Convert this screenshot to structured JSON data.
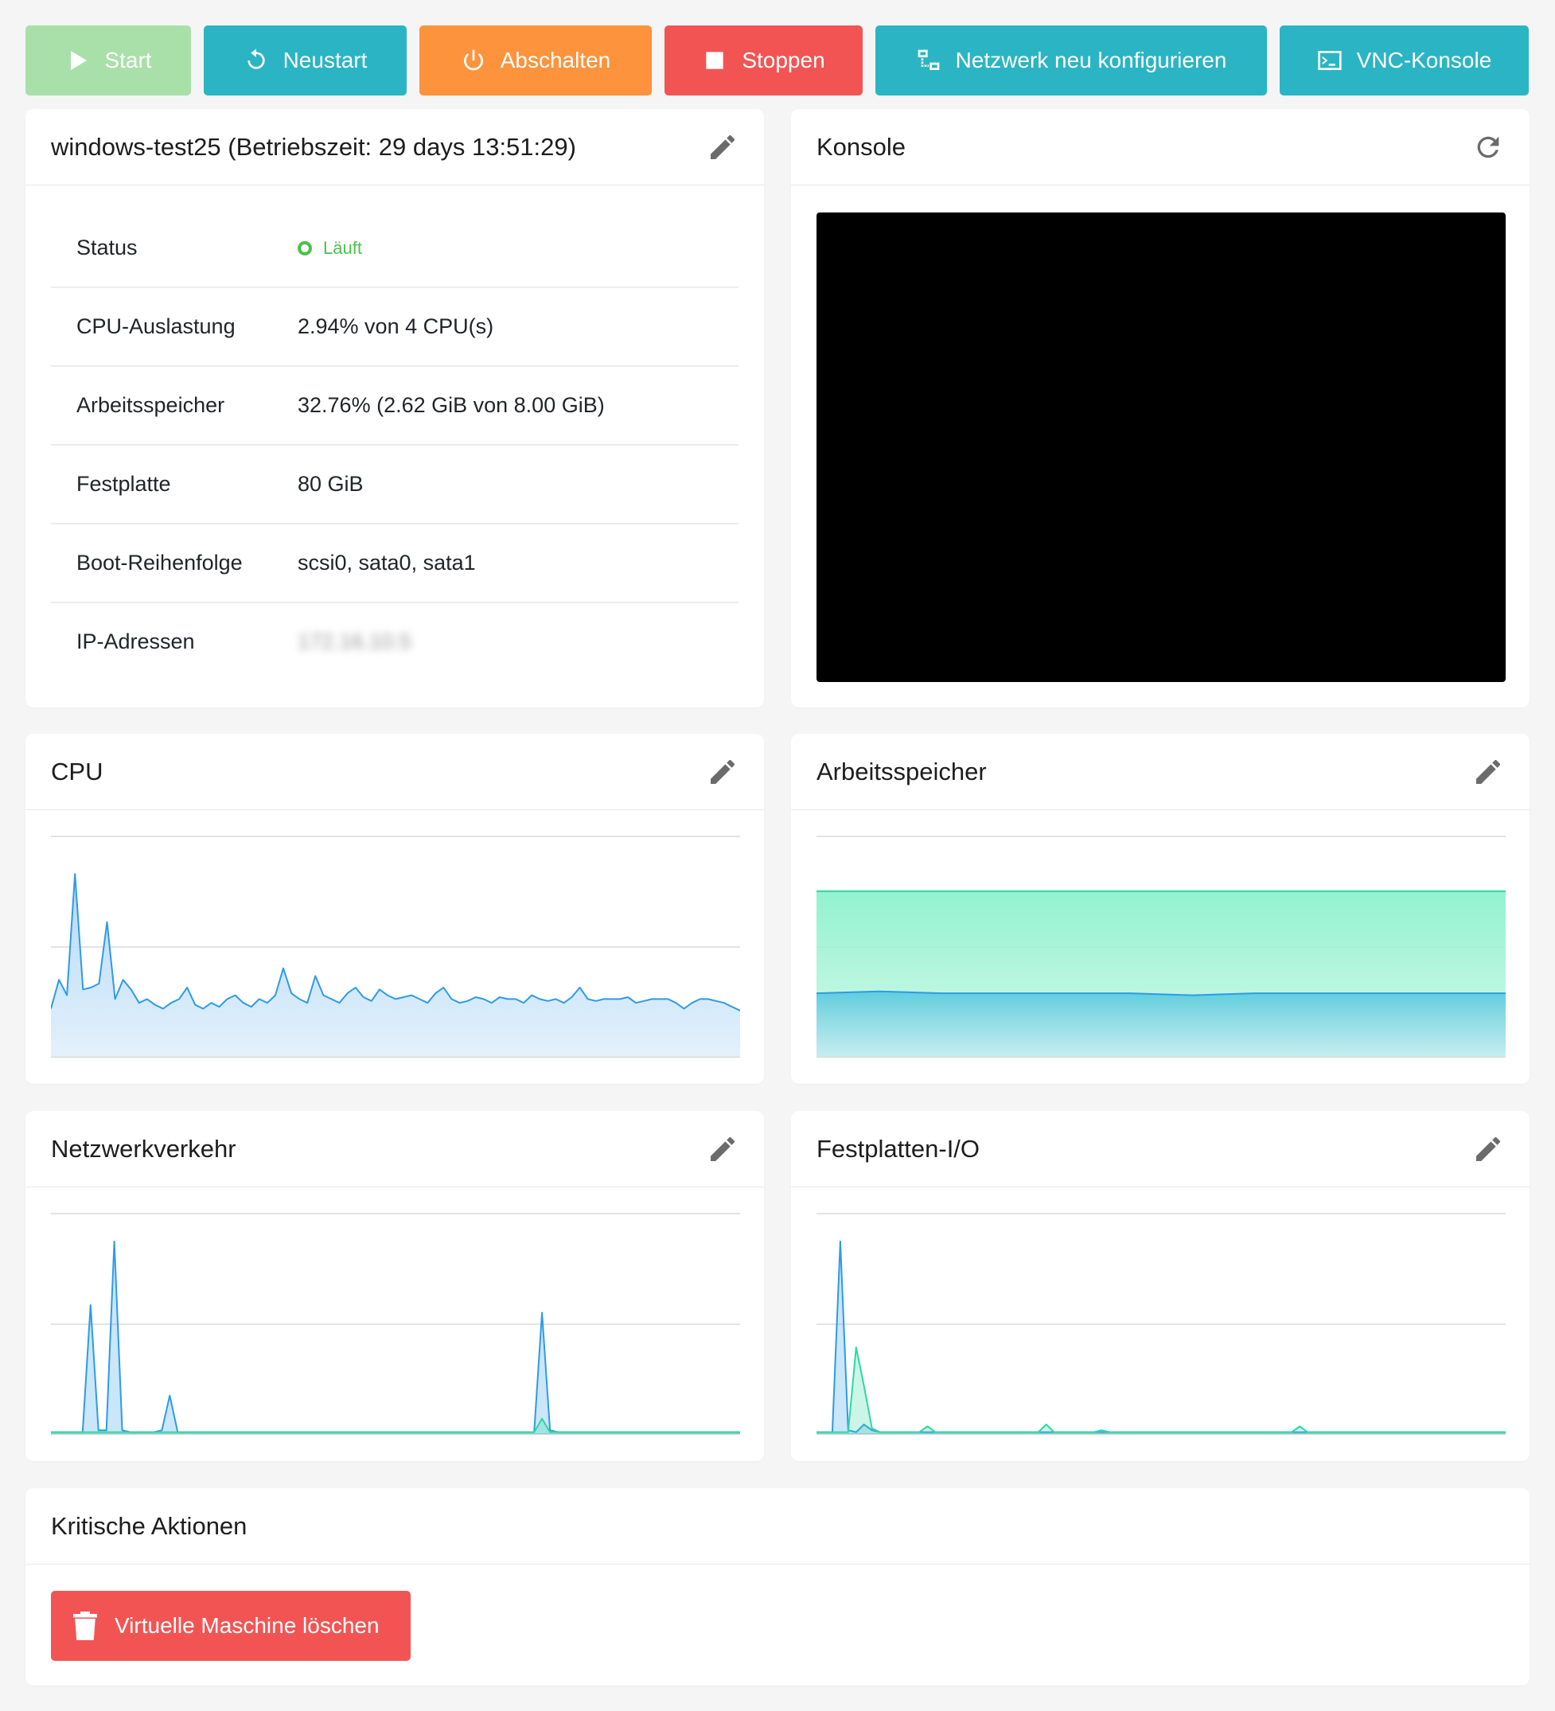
{
  "toolbar": {
    "start": "Start",
    "restart": "Neustart",
    "shutdown": "Abschalten",
    "stop": "Stoppen",
    "network": "Netzwerk neu konfigurieren",
    "vnc": "VNC-Konsole"
  },
  "vm": {
    "title": "windows-test25 (Betriebszeit: 29 days 13:51:29)",
    "rows": [
      {
        "label": "Status",
        "value": "Läuft"
      },
      {
        "label": "CPU-Auslastung",
        "value": "2.94% von 4 CPU(s)"
      },
      {
        "label": "Arbeitsspeicher",
        "value": "32.76% (2.62 GiB von 8.00 GiB)"
      },
      {
        "label": "Festplatte",
        "value": "80 GiB"
      },
      {
        "label": "Boot-Reihenfolge",
        "value": "scsi0, sata0, sata1"
      },
      {
        "label": "IP-Adressen",
        "value": "172.16.10.5"
      }
    ]
  },
  "console": {
    "title": "Konsole"
  },
  "cpu_panel": {
    "title": "CPU"
  },
  "memory_panel": {
    "title": "Arbeitsspeicher"
  },
  "network_panel": {
    "title": "Netzwerkverkehr"
  },
  "disk_panel": {
    "title": "Festplatten-I/O"
  },
  "critical": {
    "title": "Kritische Aktionen",
    "delete_button": "Virtuelle Maschine löschen"
  },
  "colors": {
    "info": "#2bb5c4",
    "warning": "#fd933c",
    "danger": "#f25454",
    "success": "#4cc14c",
    "chart_blue": "#2d9be6",
    "chart_green": "#2ed89f"
  },
  "chart_data": [
    {
      "type": "area",
      "name": "cpu",
      "ylim": [
        0,
        1
      ],
      "series": [
        {
          "values": [
            0.25,
            0.4,
            0.32,
            0.95,
            0.35,
            0.36,
            0.38,
            0.7,
            0.3,
            0.4,
            0.35,
            0.28,
            0.3,
            0.27,
            0.25,
            0.28,
            0.3,
            0.36,
            0.27,
            0.25,
            0.28,
            0.26,
            0.3,
            0.32,
            0.28,
            0.26,
            0.3,
            0.28,
            0.32,
            0.46,
            0.33,
            0.3,
            0.28,
            0.42,
            0.32,
            0.3,
            0.28,
            0.33,
            0.36,
            0.31,
            0.29,
            0.35,
            0.32,
            0.3,
            0.31,
            0.32,
            0.3,
            0.28,
            0.33,
            0.36,
            0.3,
            0.28,
            0.29,
            0.31,
            0.3,
            0.28,
            0.31,
            0.3,
            0.3,
            0.28,
            0.32,
            0.3,
            0.29,
            0.3,
            0.28,
            0.31,
            0.36,
            0.3,
            0.29,
            0.3,
            0.3,
            0.3,
            0.31,
            0.28,
            0.29,
            0.3,
            0.3,
            0.3,
            0.28,
            0.25,
            0.28,
            0.3,
            0.3,
            0.29,
            0.28,
            0.26,
            0.24
          ]
        }
      ]
    },
    {
      "type": "area",
      "name": "memory",
      "ylim": [
        0,
        1
      ],
      "series": [
        {
          "values": [
            0.86,
            0.86,
            0.86,
            0.86,
            0.86,
            0.86,
            0.86,
            0.86,
            0.86,
            0.86,
            0.86,
            0.86
          ]
        },
        {
          "values": [
            0.33,
            0.34,
            0.33,
            0.33,
            0.33,
            0.33,
            0.32,
            0.33,
            0.33,
            0.33,
            0.33,
            0.33
          ]
        }
      ]
    },
    {
      "type": "area",
      "name": "network",
      "ylim": [
        0,
        1
      ],
      "series": [
        {
          "values": [
            0.01,
            0.01,
            0.01,
            0.01,
            0.01,
            0.67,
            0.02,
            0.02,
            1.0,
            0.02,
            0.01,
            0.01,
            0.01,
            0.01,
            0.02,
            0.2,
            0.01,
            0.01,
            0.01,
            0.01,
            0.01,
            0.01,
            0.01,
            0.01,
            0.01,
            0.01,
            0.01,
            0.01,
            0.01,
            0.01,
            0.01,
            0.01,
            0.01,
            0.01,
            0.01,
            0.01,
            0.01,
            0.01,
            0.01,
            0.01,
            0.01,
            0.01,
            0.01,
            0.01,
            0.01,
            0.01,
            0.01,
            0.01,
            0.01,
            0.01,
            0.01,
            0.01,
            0.01,
            0.01,
            0.01,
            0.01,
            0.01,
            0.01,
            0.01,
            0.01,
            0.01,
            0.01,
            0.63,
            0.02,
            0.01,
            0.01,
            0.01,
            0.01,
            0.01,
            0.01,
            0.01,
            0.01,
            0.01,
            0.01,
            0.01,
            0.01,
            0.01,
            0.01,
            0.01,
            0.01,
            0.01,
            0.01,
            0.01,
            0.01,
            0.01,
            0.01,
            0.01,
            0.01
          ]
        },
        {
          "values": [
            0.01,
            0.01,
            0.01,
            0.01,
            0.01,
            0.01,
            0.01,
            0.01,
            0.01,
            0.01,
            0.01,
            0.01,
            0.01,
            0.01,
            0.01,
            0.01,
            0.01,
            0.01,
            0.01,
            0.01,
            0.01,
            0.01,
            0.01,
            0.01,
            0.01,
            0.01,
            0.01,
            0.01,
            0.01,
            0.01,
            0.01,
            0.01,
            0.01,
            0.01,
            0.01,
            0.01,
            0.01,
            0.01,
            0.01,
            0.01,
            0.01,
            0.01,
            0.01,
            0.01,
            0.01,
            0.01,
            0.01,
            0.01,
            0.01,
            0.01,
            0.01,
            0.01,
            0.01,
            0.01,
            0.01,
            0.01,
            0.01,
            0.01,
            0.01,
            0.01,
            0.01,
            0.01,
            0.08,
            0.01,
            0.01,
            0.01,
            0.01,
            0.01,
            0.01,
            0.01,
            0.01,
            0.01,
            0.01,
            0.01,
            0.01,
            0.01,
            0.01,
            0.01,
            0.01,
            0.01,
            0.01,
            0.01,
            0.01,
            0.01,
            0.01,
            0.01,
            0.01,
            0.01
          ]
        }
      ]
    },
    {
      "type": "area",
      "name": "disk",
      "ylim": [
        0,
        1
      ],
      "series": [
        {
          "values": [
            0.01,
            0.01,
            0.01,
            1.0,
            0.02,
            0.01,
            0.05,
            0.02,
            0.01,
            0.01,
            0.01,
            0.01,
            0.01,
            0.01,
            0.01,
            0.01,
            0.01,
            0.01,
            0.01,
            0.01,
            0.01,
            0.01,
            0.01,
            0.01,
            0.01,
            0.01,
            0.01,
            0.01,
            0.01,
            0.01,
            0.01,
            0.01,
            0.01,
            0.01,
            0.01,
            0.01,
            0.01,
            0.01,
            0.01,
            0.01,
            0.01,
            0.01,
            0.01,
            0.01,
            0.01,
            0.01,
            0.01,
            0.01,
            0.01,
            0.01,
            0.01,
            0.01,
            0.01,
            0.01,
            0.01,
            0.01,
            0.01,
            0.01,
            0.01,
            0.01,
            0.01,
            0.01,
            0.01,
            0.01,
            0.01,
            0.01,
            0.01,
            0.01,
            0.01,
            0.01,
            0.01,
            0.01,
            0.01,
            0.01,
            0.01,
            0.01,
            0.01,
            0.01,
            0.01,
            0.01,
            0.01,
            0.01,
            0.01,
            0.01,
            0.01,
            0.01,
            0.01,
            0.01
          ]
        },
        {
          "values": [
            0.01,
            0.01,
            0.01,
            0.01,
            0.01,
            0.45,
            0.25,
            0.03,
            0.01,
            0.01,
            0.01,
            0.01,
            0.01,
            0.01,
            0.04,
            0.01,
            0.01,
            0.01,
            0.01,
            0.01,
            0.01,
            0.01,
            0.01,
            0.01,
            0.01,
            0.01,
            0.01,
            0.01,
            0.01,
            0.05,
            0.01,
            0.01,
            0.01,
            0.01,
            0.01,
            0.01,
            0.02,
            0.01,
            0.01,
            0.01,
            0.01,
            0.01,
            0.01,
            0.01,
            0.01,
            0.01,
            0.01,
            0.01,
            0.01,
            0.01,
            0.01,
            0.01,
            0.01,
            0.01,
            0.01,
            0.01,
            0.01,
            0.01,
            0.01,
            0.01,
            0.01,
            0.04,
            0.01,
            0.01,
            0.01,
            0.01,
            0.01,
            0.01,
            0.01,
            0.01,
            0.01,
            0.01,
            0.01,
            0.01,
            0.01,
            0.01,
            0.01,
            0.01,
            0.01,
            0.01,
            0.01,
            0.01,
            0.01,
            0.01,
            0.01,
            0.01,
            0.01,
            0.01
          ]
        }
      ]
    }
  ]
}
